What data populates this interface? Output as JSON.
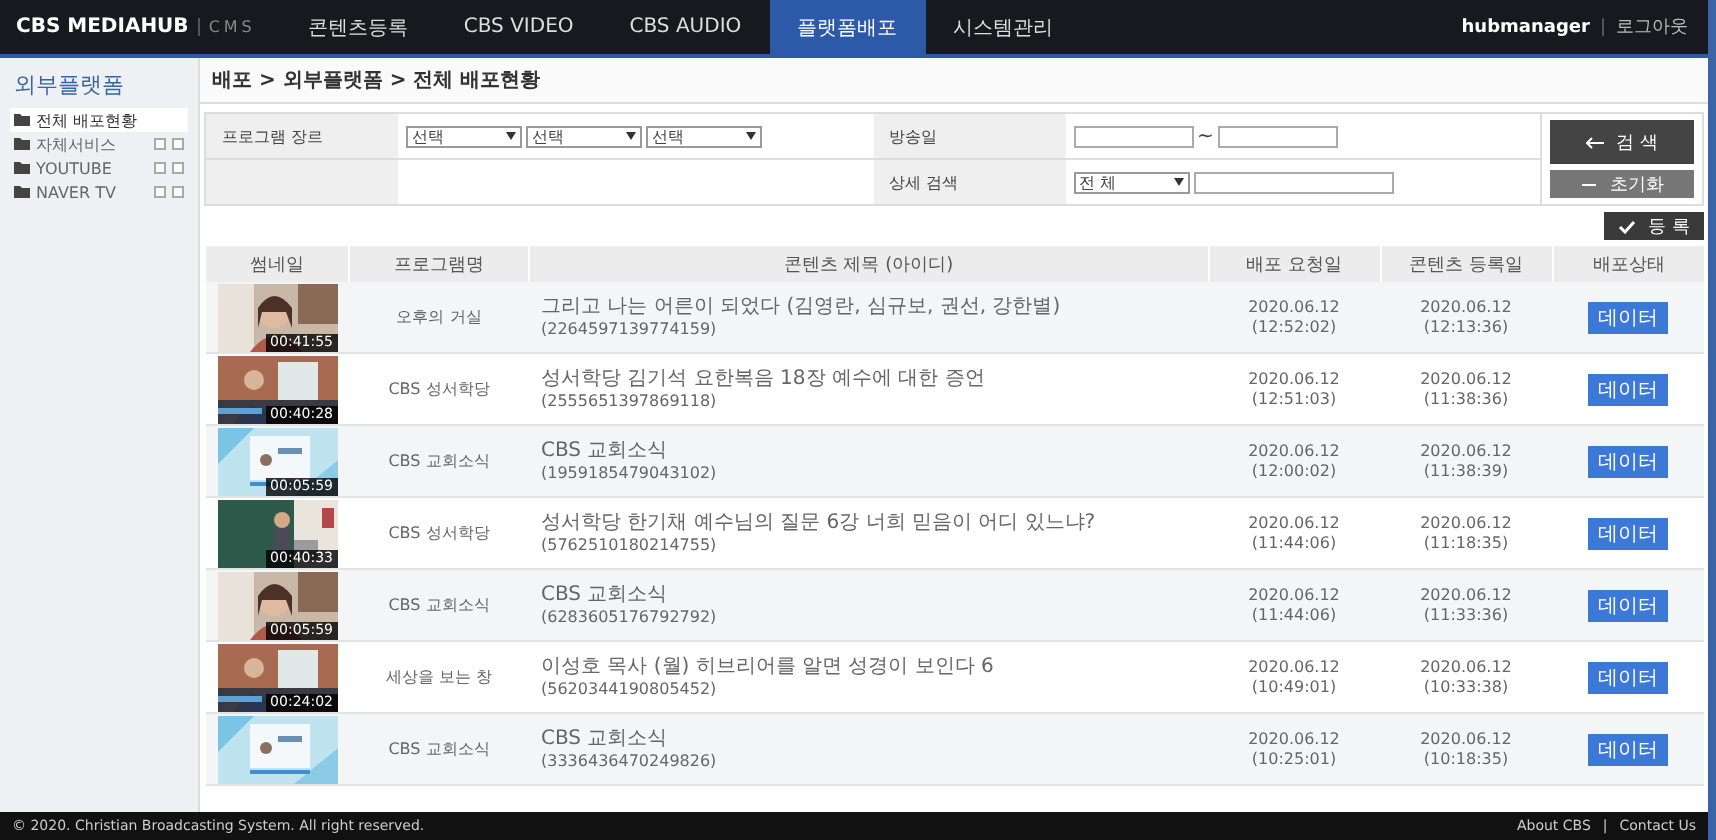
{
  "header": {
    "logo": "CBS MEDIAHUB",
    "logo_sub": "CMS",
    "nav": [
      {
        "label": "콘텐츠등록",
        "selected": false
      },
      {
        "label": "CBS VIDEO",
        "selected": false
      },
      {
        "label": "CBS AUDIO",
        "selected": false
      },
      {
        "label": "플랫폼배포",
        "selected": true
      },
      {
        "label": "시스템관리",
        "selected": false
      }
    ],
    "user": "hubmanager",
    "separator": "|",
    "logout": "로그아웃"
  },
  "sidebar": {
    "title": "외부플랫폼",
    "items": [
      {
        "label": "전체 배포현황",
        "selected": true,
        "expandable": false
      },
      {
        "label": "자체서비스",
        "selected": false,
        "expandable": true
      },
      {
        "label": "YOUTUBE",
        "selected": false,
        "expandable": true
      },
      {
        "label": "NAVER TV",
        "selected": false,
        "expandable": true
      }
    ]
  },
  "breadcrumb": "배포 > 외부플랫폼 > 전체 배포현황",
  "search": {
    "genre_label": "프로그램 장르",
    "genre_selects": [
      "선택",
      "선택",
      "선택"
    ],
    "date_label": "방송일",
    "date_separator": "~",
    "detail_label": "상세 검색",
    "detail_select": "전 체",
    "search_button": "검 색",
    "reset_button": "초기화",
    "register_button": "등 록"
  },
  "table": {
    "columns": [
      "썸네일",
      "프로그램명",
      "콘텐츠 제목 (아이디)",
      "배포 요청일",
      "콘텐츠 등록일",
      "배포상태"
    ],
    "rows": [
      {
        "duration": "00:41:55",
        "program": "오후의 거실",
        "title": "그리고 나는 어른이 되었다 (김영란, 심규보, 권선, 강한별)",
        "id": "(2264597139774159)",
        "request_date": "2020.06.12",
        "request_time": "(12:52:02)",
        "reg_date": "2020.06.12",
        "reg_time": "(12:13:36)",
        "status": "데이터"
      },
      {
        "duration": "00:40:28",
        "program": "CBS 성서학당",
        "title": "성서학당 김기석 요한복음 18장 예수에 대한 증언",
        "id": "(2555651397869118)",
        "request_date": "2020.06.12",
        "request_time": "(12:51:03)",
        "reg_date": "2020.06.12",
        "reg_time": "(11:38:36)",
        "status": "데이터"
      },
      {
        "duration": "00:05:59",
        "program": "CBS 교회소식",
        "title": "CBS 교회소식",
        "id": "(1959185479043102)",
        "request_date": "2020.06.12",
        "request_time": "(12:00:02)",
        "reg_date": "2020.06.12",
        "reg_time": "(11:38:39)",
        "status": "데이터"
      },
      {
        "duration": "00:40:33",
        "program": "CBS 성서학당",
        "title": "성서학당 한기채 예수님의 질문 6강 너희 믿음이 어디 있느냐?",
        "id": "(5762510180214755)",
        "request_date": "2020.06.12",
        "request_time": "(11:44:06)",
        "reg_date": "2020.06.12",
        "reg_time": "(11:18:35)",
        "status": "데이터"
      },
      {
        "duration": "00:05:59",
        "program": "CBS 교회소식",
        "title": "CBS 교회소식",
        "id": "(6283605176792792)",
        "request_date": "2020.06.12",
        "request_time": "(11:44:06)",
        "reg_date": "2020.06.12",
        "reg_time": "(11:33:36)",
        "status": "데이터"
      },
      {
        "duration": "00:24:02",
        "program": "세상을 보는 창",
        "title": "이성호 목사 (월) 히브리어를 알면 성경이 보인다 6",
        "id": "(5620344190805452)",
        "request_date": "2020.06.12",
        "request_time": "(10:49:01)",
        "reg_date": "2020.06.12",
        "reg_time": "(10:33:38)",
        "status": "데이터"
      },
      {
        "program": "CBS 교회소식",
        "title": "CBS 교회소식",
        "id": "(3336436470249826)",
        "request_date": "2020.06.12",
        "request_time": "(10:25:01)",
        "reg_date": "2020.06.12",
        "reg_time": "(10:18:35)",
        "status": "데이터"
      }
    ]
  },
  "footer": {
    "copyright": "© 2020. Christian Broadcasting System. All right reserved.",
    "links": [
      "About CBS",
      "Contact Us"
    ],
    "separator": "|"
  }
}
